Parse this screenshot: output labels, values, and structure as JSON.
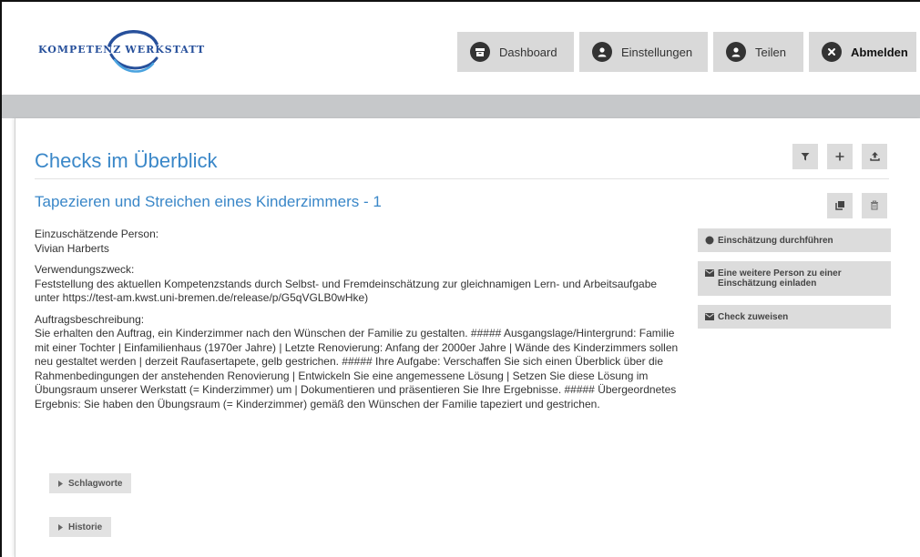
{
  "brand": {
    "logo_left": "KOMPETENZ",
    "logo_right": "WERKSTATT"
  },
  "nav": {
    "dashboard": "Dashboard",
    "settings": "Einstellungen",
    "share": "Teilen",
    "logout": "Abmelden"
  },
  "page": {
    "title": "Checks im Überblick"
  },
  "check": {
    "title": "Tapezieren und Streichen eines Kinderzimmers - 1",
    "person_label": "Einzuschätzende Person:",
    "person_value": "Vivian Harberts",
    "purpose_label": "Verwendungszweck:",
    "purpose_value": "Feststellung des aktuellen Kompetenzstands durch Selbst- und Fremdeinschätzung zur gleichnamigen Lern- und Arbeitsaufgabe unter https://test-am.kwst.uni-bremen.de/release/p/G5qVGLB0wHke)",
    "task_label": "Auftragsbeschreibung:",
    "task_value": "Sie erhalten den Auftrag, ein Kinderzimmer nach den Wünschen der Familie zu gestalten. ##### Ausgangslage/Hintergrund: Familie mit einer Tochter | Einfamilienhaus (1970er Jahre) | Letzte Renovierung: Anfang der 2000er Jahre | Wände des Kinderzimmers sollen neu gestaltet werden | derzeit Raufasertapete, gelb gestrichen. ##### Ihre Aufgabe: Verschaffen Sie sich einen Überblick über die Rahmenbedingungen der anstehenden Renovierung | Entwickeln Sie eine angemessene Lösung | Setzen Sie diese Lösung im Übungsraum unserer Werkstatt (= Kinderzimmer) um | Dokumentieren und präsentieren Sie Ihre Ergebnisse. ##### Übergeordnetes Ergebnis: Sie haben den Übungsraum (= Kinderzimmer) gemäß den Wünschen der Familie tapeziert und gestrichen."
  },
  "actions": {
    "assess": "Einschätzung durchführen",
    "invite": "Eine weitere Person zu einer Einschätzung einladen",
    "assign": "Check zuweisen"
  },
  "toggles": {
    "tags": "Schlagworte",
    "history": "Historie"
  },
  "icons": {
    "filter": "filter-icon",
    "add": "plus-icon",
    "upload": "upload-icon",
    "copy": "copy-icon",
    "delete": "trash-icon",
    "dot": "circle-icon",
    "envelope": "envelope-icon",
    "caret": "caret-right-icon"
  },
  "colors": {
    "accent": "#3a87c8",
    "brand": "#27509b",
    "button": "#d9d9d9",
    "band": "#c6c8ca"
  }
}
